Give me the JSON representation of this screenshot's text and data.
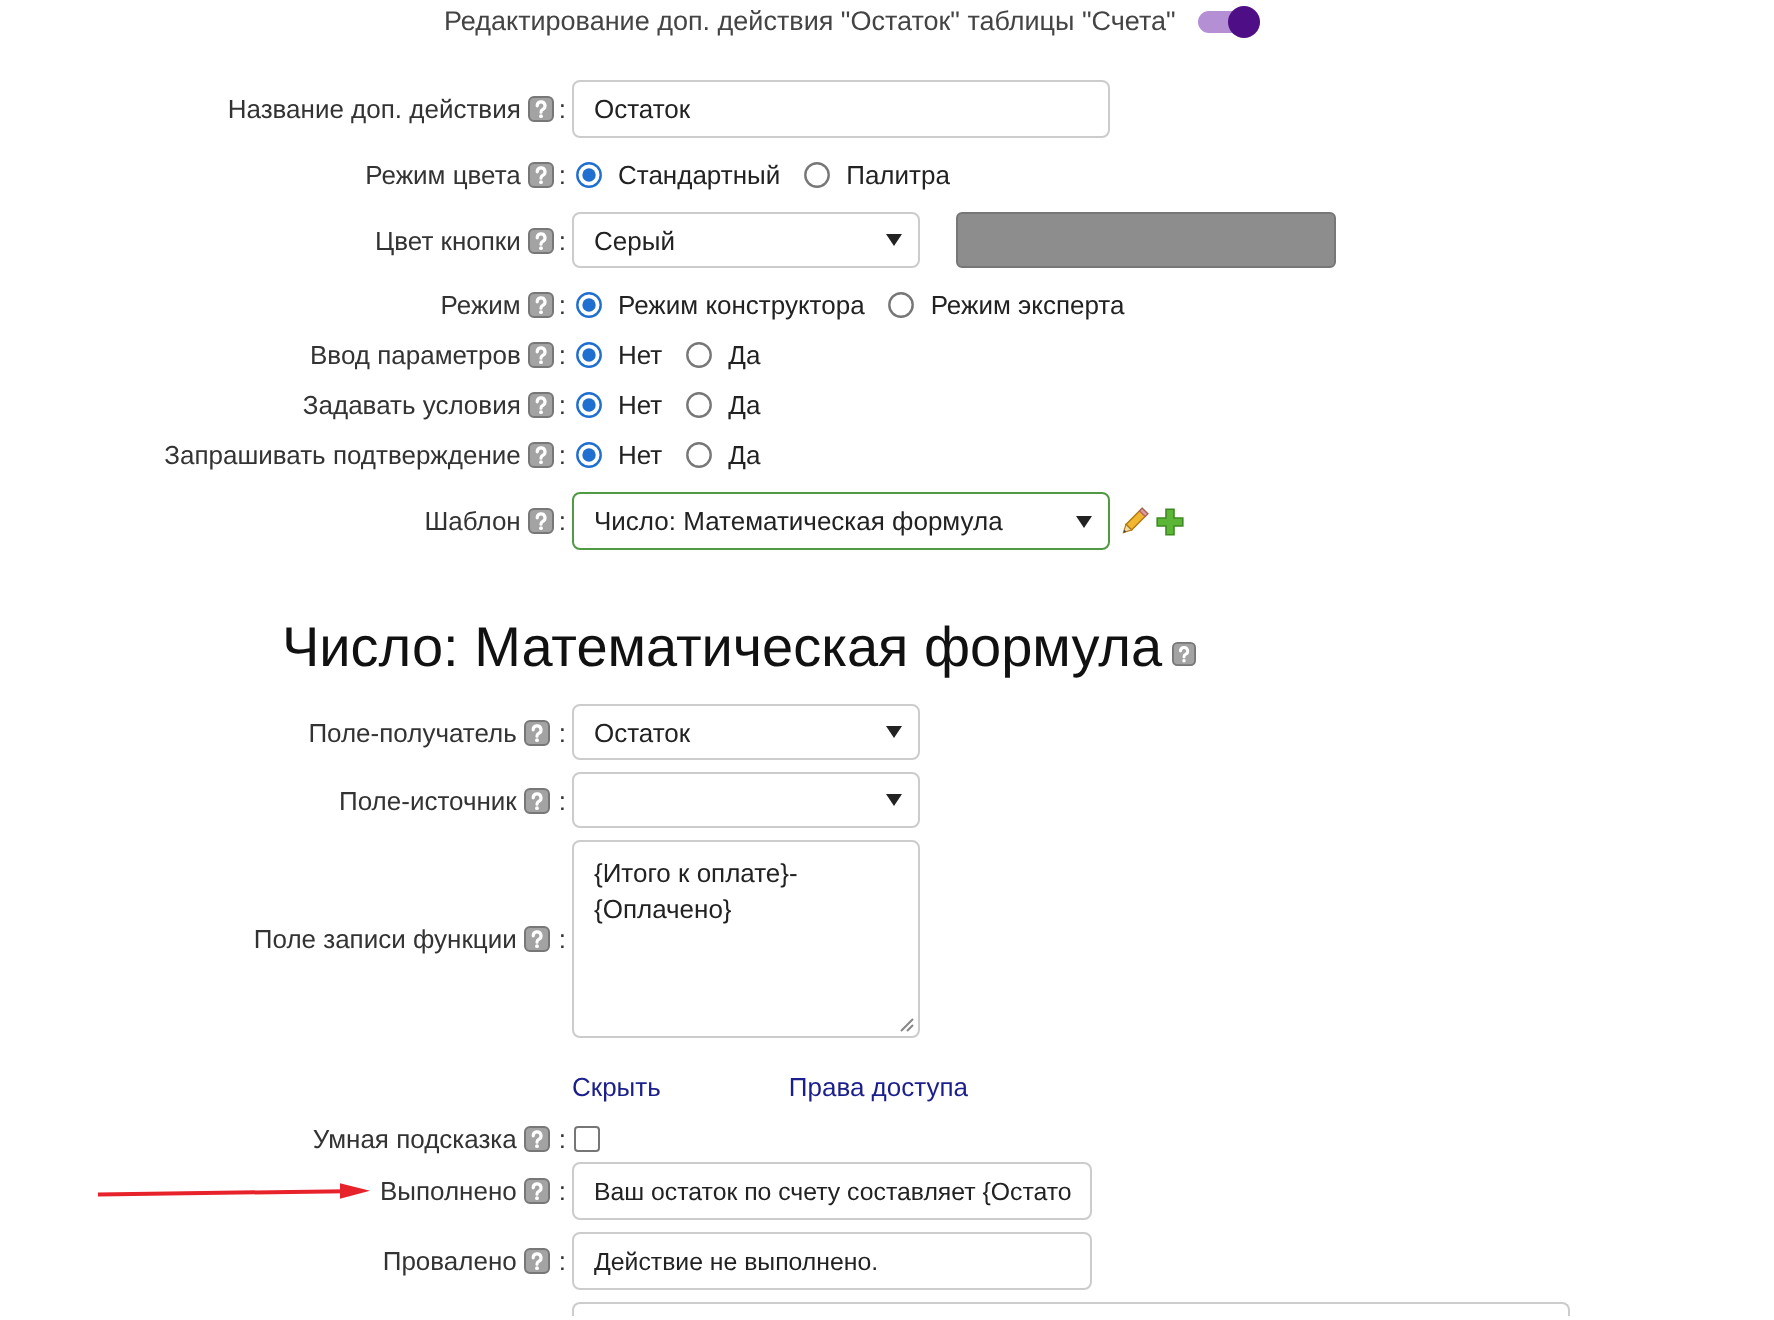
{
  "header": {
    "title": "Редактирование доп. действия \"Остаток\" таблицы \"Счета\"",
    "toggle": {
      "on": true
    }
  },
  "settings": [
    {
      "kind": "text",
      "label": "Название доп. действия",
      "sep": ":",
      "value": "Остаток"
    },
    {
      "kind": "radio",
      "label": "Режим цвета",
      "sep": ":",
      "options": [
        {
          "label": "Стандартный",
          "selected": true
        },
        {
          "label": "Палитра",
          "selected": false
        }
      ]
    },
    {
      "kind": "color_select",
      "label": "Цвет кнопки",
      "sep": ":",
      "value": "Серый",
      "focused": false
    },
    {
      "kind": "radio",
      "label": "Режим",
      "sep": ":",
      "options": [
        {
          "label": "Режим конструктора",
          "selected": true
        },
        {
          "label": "Режим эксперта",
          "selected": false
        }
      ]
    },
    {
      "kind": "radio",
      "label": "Ввод параметров",
      "sep": ":",
      "options": [
        {
          "label": "Нет",
          "selected": true
        },
        {
          "label": "Да",
          "selected": false
        }
      ]
    },
    {
      "kind": "radio",
      "label": "Задавать условия",
      "sep": ":",
      "options": [
        {
          "label": "Нет",
          "selected": true
        },
        {
          "label": "Да",
          "selected": false
        }
      ]
    },
    {
      "kind": "radio",
      "label": "Запрашивать подтверждение",
      "sep": ":",
      "options": [
        {
          "label": "Нет",
          "selected": true
        },
        {
          "label": "Да",
          "selected": false
        }
      ]
    },
    {
      "kind": "template_select",
      "label": "Шаблон",
      "sep": ":",
      "value": "Число: Математическая формула",
      "focused": true
    }
  ],
  "formula": {
    "title": "Число: Математическая формула",
    "fields": [
      {
        "kind": "select",
        "label": "Поле-получатель",
        "sep": ":",
        "value": "Остаток",
        "focused": false
      },
      {
        "kind": "select",
        "label": "Поле-источник",
        "sep": ":",
        "focused": false
      },
      {
        "kind": "textarea",
        "label": "Поле записи функции",
        "sep": ":",
        "value": "{Итого к оплате}-{Оплачено}"
      },
      {
        "kind": "links",
        "links": [
          "Скрыть",
          "Права доступа"
        ]
      },
      {
        "kind": "checkbox",
        "label": "Умная подсказка",
        "sep": ":",
        "checked": false
      },
      {
        "kind": "text",
        "label": "Выполнено",
        "sep": ":",
        "value": "Ваш остаток по счету составляет {Остато",
        "arrow": true
      },
      {
        "kind": "text",
        "label": "Провалено",
        "sep": ":",
        "value": "Действие не выполнено."
      },
      {
        "kind": "partial"
      }
    ]
  }
}
